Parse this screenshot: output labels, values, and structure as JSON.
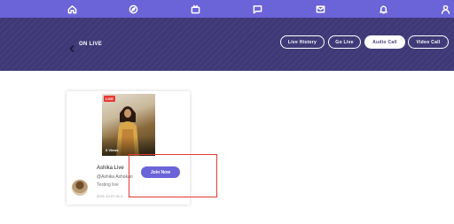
{
  "topnav": {
    "icons": [
      "home-icon",
      "compass-icon",
      "tv-icon",
      "chat-icon",
      "mail-icon",
      "bell-icon",
      "user-icon"
    ],
    "background": "#6b63d8"
  },
  "banner": {
    "title": "ON LIVE",
    "tabs": [
      {
        "label": "Live History",
        "active": false
      },
      {
        "label": "Go Live",
        "active": false
      },
      {
        "label": "Audio Call",
        "active": true
      },
      {
        "label": "Video Call",
        "active": false
      }
    ],
    "background": "#3f3a78"
  },
  "card": {
    "badge": "LIVE",
    "views": "0 Views",
    "name": "Ashika Live",
    "handle": "@Ashika Ashokan",
    "description": "Testing live",
    "date": "2021-12-07 01:1...",
    "join_label": "Join Now",
    "accent": "#6b63d8"
  }
}
